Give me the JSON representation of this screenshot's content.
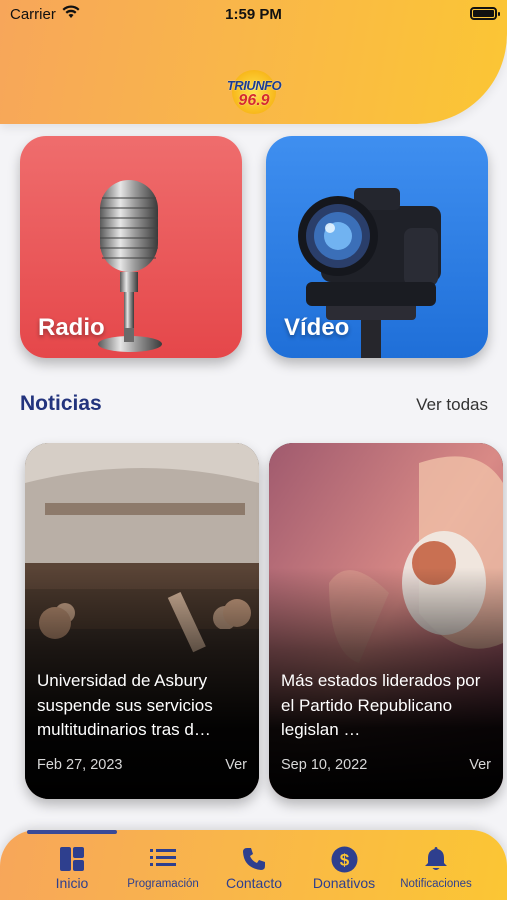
{
  "status_bar": {
    "carrier": "Carrier",
    "time": "1:59 PM"
  },
  "header": {
    "logo_top": "TRIUNFO",
    "logo_bottom": "96.9"
  },
  "media": [
    {
      "label": "Radio",
      "color": "#e5474a"
    },
    {
      "label": "Vídeo",
      "color": "#2a7ce2"
    }
  ],
  "news_section": {
    "title": "Noticias",
    "see_all": "Ver todas"
  },
  "news": [
    {
      "title": "Universidad de Asbury suspende sus servicios multitudinarios tras d…",
      "date": "Feb 27, 2023",
      "more": "Ver"
    },
    {
      "title": "Más estados liderados por el Partido Republicano legislan …",
      "date": "Sep 10, 2022",
      "more": "Ver"
    }
  ],
  "tabs": [
    {
      "label": "Inicio",
      "icon": "grid-icon",
      "active": true
    },
    {
      "label": "Programación",
      "icon": "list-icon"
    },
    {
      "label": "Contacto",
      "icon": "phone-icon"
    },
    {
      "label": "Donativos",
      "icon": "dollar-icon"
    },
    {
      "label": "Notificaciones",
      "icon": "bell-icon"
    }
  ],
  "colors": {
    "accent": "#22337d",
    "header_start": "#f7a65a",
    "header_end": "#fbc634"
  }
}
